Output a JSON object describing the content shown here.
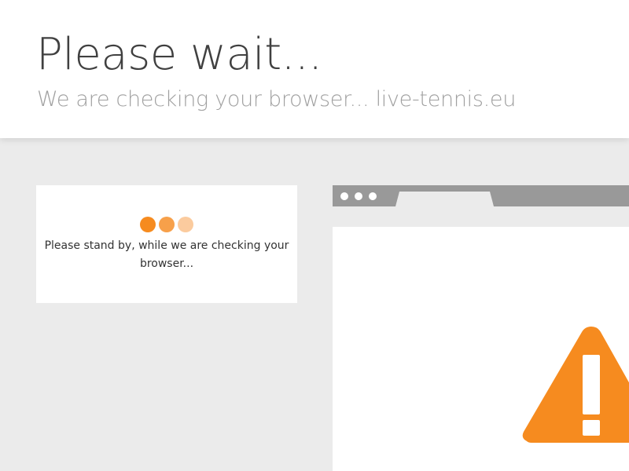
{
  "header": {
    "title": "Please wait...",
    "subtitle": "We are checking your browser... live-tennis.eu"
  },
  "card": {
    "message": "Please stand by, while we are checking your browser...",
    "loader_dots": [
      "#f68b1f",
      "#f7a04a",
      "#fbcb9e"
    ]
  },
  "illustration": {
    "icons": [
      "browser-window-icon",
      "warning-icon"
    ],
    "warning_color": "#f68b1f",
    "window_bar_color": "#999999"
  },
  "colors": {
    "background": "#ebebeb",
    "accent": "#f68b1f"
  }
}
